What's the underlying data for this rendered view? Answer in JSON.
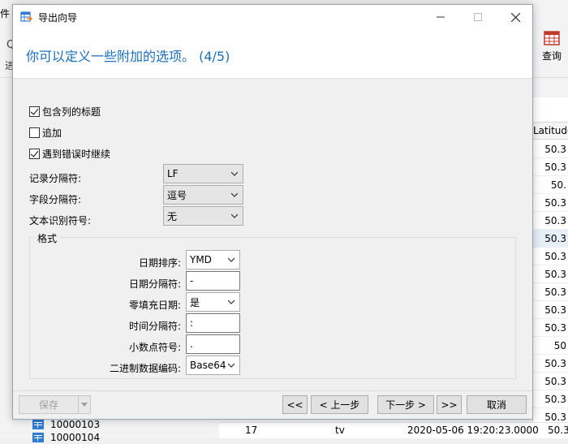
{
  "background": {
    "menu_fragment": "件",
    "left_glyph_top": "Q",
    "left_glyph_bottom": "进",
    "toolbar_query_label": "查询",
    "grid_header": "Latitude",
    "grid_values": [
      "50.3",
      "50.3",
      "50.",
      "50.3",
      "50.3",
      "50.3",
      "50.3",
      "50.3",
      "50.3",
      "50.3",
      "50.3",
      "50",
      "50.3",
      "50.3",
      "50.3",
      "50.3",
      "50.3"
    ],
    "tree_items": [
      "10000103",
      "10000104"
    ],
    "bottom_row": {
      "num": "17",
      "col2": "tv",
      "date": "2020-05-06 19:20:23.0000",
      "value": "50.3"
    }
  },
  "dialog": {
    "title": "导出向导",
    "step_title": "你可以定义一些附加的选项。 (4/5)",
    "options": {
      "include_headers": {
        "label": "包含列的标题",
        "checked": true
      },
      "append": {
        "label": "追加",
        "checked": false
      },
      "continue_on_error": {
        "label": "遇到错误时继续",
        "checked": true
      }
    },
    "separators": {
      "record_label": "记录分隔符:",
      "record_value": "LF",
      "field_label": "字段分隔符:",
      "field_value": "逗号",
      "text_qualifier_label": "文本识别符号:",
      "text_qualifier_value": "无"
    },
    "format": {
      "group_title": "格式",
      "date_order_label": "日期排序:",
      "date_order_value": "YMD",
      "date_sep_label": "日期分隔符:",
      "date_sep_value": "-",
      "zero_pad_label": "零填充日期:",
      "zero_pad_value": "是",
      "time_sep_label": "时间分隔符:",
      "time_sep_value": ":",
      "decimal_label": "小数点符号:",
      "decimal_value": ".",
      "binary_label": "二进制数据编码:",
      "binary_value": "Base64"
    },
    "footer": {
      "save": "保存",
      "first": "<<",
      "prev": "< 上一步",
      "next": "下一步 >",
      "last": ">>",
      "cancel": "取消"
    }
  },
  "colors": {
    "accent": "#1a6fbf",
    "title_icon": "#2f7dd1",
    "toolbar_icon": "#c0392b"
  }
}
